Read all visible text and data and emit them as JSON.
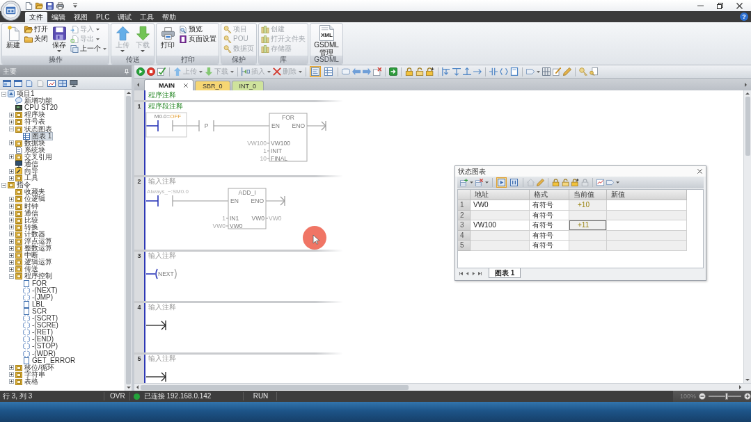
{
  "menu": {
    "tabs": [
      {
        "label": "文件",
        "selected": true
      },
      {
        "label": "编辑",
        "selected": false
      },
      {
        "label": "视图",
        "selected": false
      },
      {
        "label": "PLC",
        "selected": false
      },
      {
        "label": "调试",
        "selected": false
      },
      {
        "label": "工具",
        "selected": false
      },
      {
        "label": "帮助",
        "selected": false
      }
    ],
    "help": "?"
  },
  "ribbon": {
    "groups": [
      {
        "label": "操作",
        "columns": [
          {
            "items": [
              {
                "label": "新建",
                "kind": "large",
                "disabled": false,
                "menu": false
              }
            ]
          },
          {
            "items": [
              {
                "label": "打开",
                "kind": "small",
                "disabled": false,
                "menu": false
              },
              {
                "label": "关闭",
                "kind": "small",
                "disabled": false,
                "menu": false
              }
            ]
          },
          {
            "items": [
              {
                "label": "保存",
                "kind": "large",
                "disabled": false,
                "menu": true
              }
            ]
          },
          {
            "items": [
              {
                "label": "导入",
                "kind": "small",
                "disabled": true,
                "menu": true
              },
              {
                "label": "导出",
                "kind": "small",
                "disabled": true,
                "menu": true
              },
              {
                "label": "上一个",
                "kind": "small",
                "disabled": false,
                "menu": true
              }
            ]
          }
        ]
      },
      {
        "label": "传送",
        "columns": [
          {
            "items": [
              {
                "label": "上传",
                "kind": "large",
                "disabled": true,
                "menu": true
              }
            ]
          },
          {
            "items": [
              {
                "label": "下载",
                "kind": "large",
                "disabled": true,
                "menu": true
              }
            ]
          }
        ]
      },
      {
        "label": "打印",
        "columns": [
          {
            "items": [
              {
                "label": "打印",
                "kind": "large",
                "disabled": false,
                "menu": false
              }
            ]
          },
          {
            "items": [
              {
                "label": "预览",
                "kind": "small",
                "disabled": false,
                "menu": false
              },
              {
                "label": "页面设置",
                "kind": "small",
                "disabled": false,
                "menu": false
              }
            ]
          }
        ]
      },
      {
        "label": "保护",
        "columns": [
          {
            "items": [
              {
                "label": "项目",
                "kind": "small",
                "disabled": true,
                "menu": false
              },
              {
                "label": "POU",
                "kind": "small",
                "disabled": true,
                "menu": false
              },
              {
                "label": "数据页",
                "kind": "small",
                "disabled": true,
                "menu": false
              }
            ]
          }
        ]
      },
      {
        "label": "库",
        "columns": [
          {
            "items": [
              {
                "label": "创建",
                "kind": "small",
                "disabled": true,
                "menu": false
              },
              {
                "label": "打开文件夹",
                "kind": "small",
                "disabled": true,
                "menu": false
              },
              {
                "label": "存储器",
                "kind": "small",
                "disabled": true,
                "menu": false
              }
            ]
          }
        ]
      },
      {
        "label": "GSDML",
        "columns": [
          {
            "items": [
              {
                "label": "GSDML管理",
                "kind": "large",
                "disabled": false,
                "menu": false,
                "icon_text": "XML"
              }
            ]
          }
        ]
      }
    ]
  },
  "navigator": {
    "title": "主要",
    "tree": [
      {
        "label": "项目1",
        "kind": "project",
        "expanded": true,
        "selected": false,
        "children": [
          {
            "label": "新增功能",
            "kind": "help",
            "selected": false
          },
          {
            "label": "CPU ST20",
            "kind": "cpu",
            "selected": false
          },
          {
            "label": "程序块",
            "kind": "folder",
            "expanded": false,
            "selected": false
          },
          {
            "label": "符号表",
            "kind": "folder",
            "expanded": false,
            "selected": false
          },
          {
            "label": "状态图表",
            "kind": "folder",
            "expanded": true,
            "selected": false,
            "children": [
              {
                "label": "图表 1",
                "kind": "table",
                "selected": true
              }
            ]
          },
          {
            "label": "数据块",
            "kind": "folder",
            "expanded": false,
            "selected": false
          },
          {
            "label": "系统块",
            "kind": "document",
            "selected": false
          },
          {
            "label": "交叉引用",
            "kind": "folder",
            "expanded": false,
            "selected": false
          },
          {
            "label": "通信",
            "kind": "monitor",
            "selected": false
          },
          {
            "label": "向导",
            "kind": "wizard",
            "expanded": false,
            "selected": false
          },
          {
            "label": "工具",
            "kind": "folder",
            "expanded": false,
            "selected": false
          }
        ]
      },
      {
        "label": "指令",
        "kind": "folder",
        "expanded": true,
        "selected": false,
        "children": [
          {
            "label": "收藏夹",
            "kind": "folder",
            "selected": false
          },
          {
            "label": "位逻辑",
            "kind": "folder",
            "expanded": false,
            "selected": false
          },
          {
            "label": "时钟",
            "kind": "folder",
            "expanded": false,
            "selected": false
          },
          {
            "label": "通信",
            "kind": "folder",
            "expanded": false,
            "selected": false
          },
          {
            "label": "比较",
            "kind": "folder",
            "expanded": false,
            "selected": false
          },
          {
            "label": "转换",
            "kind": "folder",
            "expanded": false,
            "selected": false
          },
          {
            "label": "计数器",
            "kind": "folder",
            "expanded": false,
            "selected": false
          },
          {
            "label": "浮点运算",
            "kind": "folder",
            "expanded": false,
            "selected": false
          },
          {
            "label": "整数运算",
            "kind": "folder",
            "expanded": false,
            "selected": false
          },
          {
            "label": "中断",
            "kind": "folder",
            "expanded": false,
            "selected": false
          },
          {
            "label": "逻辑运算",
            "kind": "folder",
            "expanded": false,
            "selected": false
          },
          {
            "label": "传送",
            "kind": "folder",
            "expanded": false,
            "selected": false
          },
          {
            "label": "程序控制",
            "kind": "folder",
            "expanded": true,
            "selected": false,
            "children": [
              {
                "label": "FOR",
                "kind": "box",
                "selected": false
              },
              {
                "label": "-(NEXT)",
                "kind": "coil",
                "selected": false
              },
              {
                "label": "-(JMP)",
                "kind": "coil",
                "selected": false
              },
              {
                "label": "LBL",
                "kind": "box",
                "selected": false
              },
              {
                "label": "SCR",
                "kind": "box",
                "selected": false
              },
              {
                "label": "-(SCRT)",
                "kind": "coil",
                "selected": false
              },
              {
                "label": "-(SCRE)",
                "kind": "coil",
                "selected": false
              },
              {
                "label": "-(RET)",
                "kind": "coil",
                "selected": false
              },
              {
                "label": "-(END)",
                "kind": "coil",
                "selected": false
              },
              {
                "label": "-(STOP)",
                "kind": "coil",
                "selected": false
              },
              {
                "label": "-(WDR)",
                "kind": "coil",
                "selected": false
              },
              {
                "label": "GET_ERROR",
                "kind": "box",
                "selected": false
              }
            ]
          },
          {
            "label": "移位/循环",
            "kind": "folder",
            "expanded": false,
            "selected": false
          },
          {
            "label": "字符串",
            "kind": "folder",
            "expanded": false,
            "selected": false
          },
          {
            "label": "表格",
            "kind": "folder",
            "expanded": false,
            "selected": false
          }
        ]
      }
    ]
  },
  "editor": {
    "toolbar": [
      {
        "label": "上传",
        "disabled": true
      },
      {
        "label": "下载",
        "disabled": true
      },
      {
        "label": "插入",
        "disabled": true
      },
      {
        "label": "删除",
        "disabled": true
      }
    ],
    "view_toggles": [
      {
        "selected": true
      },
      {
        "selected": false
      }
    ],
    "tabs": [
      {
        "label": "MAIN",
        "selected": true,
        "color": "#ffffff",
        "closable": true
      },
      {
        "label": "SBR_0",
        "selected": false,
        "color": "#f6d673",
        "closable": false
      },
      {
        "label": "INT_0",
        "selected": false,
        "color": "#cfe39c",
        "closable": false
      }
    ],
    "program_comment": "程序注释",
    "networks": [
      {
        "number": "1",
        "comment": "程序段注释",
        "placeholder": false,
        "kind": "box",
        "contacts": [
          {
            "kind": "open",
            "operand": "M0.0=",
            "status": "OFF",
            "selected": true
          },
          {
            "kind": "transition",
            "operand": "P",
            "selected": false
          }
        ],
        "box": {
          "title": "FOR",
          "enable": "EN",
          "enable_out": "ENO",
          "inputs": [
            {
              "value": "VW100",
              "pin": "VW100"
            },
            {
              "value": "1",
              "pin": "INIT"
            },
            {
              "value": "10",
              "pin": "FINAL"
            }
          ]
        }
      },
      {
        "number": "2",
        "comment": "输入注释",
        "placeholder": true,
        "kind": "box",
        "contacts": [
          {
            "kind": "open",
            "operand": "Always_~:SM0.0",
            "selected": false
          }
        ],
        "box": {
          "title": "ADD_I",
          "enable": "EN",
          "enable_out": "ENO",
          "inputs": [
            {
              "value": "1",
              "pin": "IN1"
            },
            {
              "value": "VW0",
              "pin": "VW0"
            }
          ],
          "outputs": [
            {
              "pin": "VW0",
              "value": "VW0"
            }
          ]
        }
      },
      {
        "number": "3",
        "comment": "输入注释",
        "placeholder": true,
        "kind": "coil",
        "coil": "NEXT"
      },
      {
        "number": "4",
        "comment": "输入注释",
        "placeholder": true,
        "kind": "end"
      },
      {
        "number": "5",
        "comment": "输入注释",
        "placeholder": true,
        "kind": "end"
      }
    ]
  },
  "status_chart": {
    "title": "状态图表",
    "toggles": [
      {
        "selected": true
      },
      {
        "selected": false
      }
    ],
    "columns": [
      "地址",
      "格式",
      "当前值",
      "新值"
    ],
    "rows": [
      {
        "number": "1",
        "address": "VW0",
        "format": "有符号",
        "value": "+10",
        "selected": false
      },
      {
        "number": "2",
        "format": "有符号",
        "selected": false
      },
      {
        "number": "3",
        "address": "VW100",
        "format": "有符号",
        "value": "+11",
        "selected": true
      },
      {
        "number": "4",
        "format": "有符号",
        "selected": false
      },
      {
        "number": "5",
        "format": "有符号",
        "selected": false
      }
    ],
    "sheets": [
      {
        "label": "图表 1",
        "selected": true
      }
    ]
  },
  "status_bar": {
    "position": "行 3, 列 3",
    "mode": "OVR",
    "connected": true,
    "connection": "已连接 192.168.0.142",
    "plc_state": "RUN",
    "zoom": {
      "reading": "100%",
      "level": 0.55
    }
  }
}
